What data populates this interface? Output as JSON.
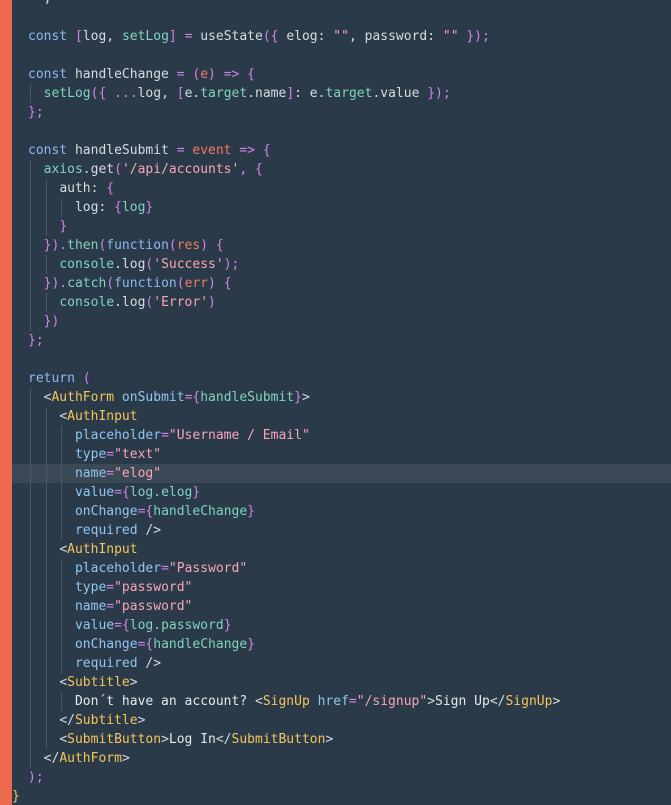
{
  "editor": {
    "colors": {
      "background": "#2b3a48",
      "gutter_accent": "#ee6a4f",
      "current_line": "#3b4956"
    },
    "current_line_index": 25,
    "lines": [
      {
        "indent": 0,
        "tokens": [
          {
            "t": "plain",
            "v": "  ,"
          }
        ]
      },
      {
        "indent": 0,
        "tokens": [
          {
            "t": "plain",
            "v": ""
          }
        ]
      },
      {
        "indent": 0,
        "tokens": [
          {
            "t": "keyword",
            "v": "const "
          },
          {
            "t": "punct",
            "v": "["
          },
          {
            "t": "plain",
            "v": "log, "
          },
          {
            "t": "variable",
            "v": "setLog"
          },
          {
            "t": "punct",
            "v": "] "
          },
          {
            "t": "operator",
            "v": "="
          },
          {
            "t": "plain",
            "v": " useState"
          },
          {
            "t": "punct",
            "v": "({ "
          },
          {
            "t": "plain",
            "v": "elog: "
          },
          {
            "t": "string",
            "v": "\"\""
          },
          {
            "t": "plain",
            "v": ", password: "
          },
          {
            "t": "string",
            "v": "\"\""
          },
          {
            "t": "punct",
            "v": " });"
          }
        ]
      },
      {
        "indent": 0,
        "tokens": [
          {
            "t": "plain",
            "v": ""
          }
        ]
      },
      {
        "indent": 0,
        "tokens": [
          {
            "t": "keyword",
            "v": "const "
          },
          {
            "t": "plain",
            "v": "handleChange "
          },
          {
            "t": "operator",
            "v": "="
          },
          {
            "t": "punct",
            "v": " ("
          },
          {
            "t": "param",
            "v": "e"
          },
          {
            "t": "punct",
            "v": ") "
          },
          {
            "t": "operator",
            "v": "=>"
          },
          {
            "t": "punct",
            "v": " {"
          }
        ]
      },
      {
        "indent": 1,
        "tokens": [
          {
            "t": "variable",
            "v": "setLog"
          },
          {
            "t": "punct",
            "v": "({ "
          },
          {
            "t": "operator",
            "v": "..."
          },
          {
            "t": "plain",
            "v": "log, "
          },
          {
            "t": "punct",
            "v": "["
          },
          {
            "t": "plain",
            "v": "e."
          },
          {
            "t": "variable",
            "v": "target"
          },
          {
            "t": "plain",
            "v": ".name"
          },
          {
            "t": "punct",
            "v": "]"
          },
          {
            "t": "plain",
            "v": ": e."
          },
          {
            "t": "variable",
            "v": "target"
          },
          {
            "t": "plain",
            "v": ".value "
          },
          {
            "t": "punct",
            "v": "});"
          }
        ]
      },
      {
        "indent": 0,
        "tokens": [
          {
            "t": "punct",
            "v": "};"
          }
        ]
      },
      {
        "indent": 0,
        "tokens": [
          {
            "t": "plain",
            "v": ""
          }
        ]
      },
      {
        "indent": 0,
        "tokens": [
          {
            "t": "keyword",
            "v": "const "
          },
          {
            "t": "plain",
            "v": "handleSubmit "
          },
          {
            "t": "operator",
            "v": "="
          },
          {
            "t": "param",
            "v": " event "
          },
          {
            "t": "operator",
            "v": "=>"
          },
          {
            "t": "punct",
            "v": " {"
          }
        ]
      },
      {
        "indent": 1,
        "tokens": [
          {
            "t": "variable",
            "v": "axios"
          },
          {
            "t": "plain",
            "v": ".get"
          },
          {
            "t": "punct",
            "v": "("
          },
          {
            "t": "string",
            "v": "'/api/accounts'"
          },
          {
            "t": "punct",
            "v": ", {"
          }
        ]
      },
      {
        "indent": 2,
        "tokens": [
          {
            "t": "plain",
            "v": "auth: "
          },
          {
            "t": "punct",
            "v": "{"
          }
        ]
      },
      {
        "indent": 3,
        "tokens": [
          {
            "t": "plain",
            "v": "log: "
          },
          {
            "t": "punct",
            "v": "{"
          },
          {
            "t": "variable",
            "v": "log"
          },
          {
            "t": "punct",
            "v": "}"
          }
        ]
      },
      {
        "indent": 2,
        "tokens": [
          {
            "t": "punct",
            "v": "}"
          }
        ]
      },
      {
        "indent": 1,
        "tokens": [
          {
            "t": "punct",
            "v": "})."
          },
          {
            "t": "variable",
            "v": "then"
          },
          {
            "t": "punct",
            "v": "("
          },
          {
            "t": "keyword",
            "v": "function"
          },
          {
            "t": "punct",
            "v": "("
          },
          {
            "t": "param",
            "v": "res"
          },
          {
            "t": "punct",
            "v": ") {"
          }
        ]
      },
      {
        "indent": 2,
        "tokens": [
          {
            "t": "variable",
            "v": "console"
          },
          {
            "t": "plain",
            "v": ".log"
          },
          {
            "t": "punct",
            "v": "("
          },
          {
            "t": "string",
            "v": "'Success'"
          },
          {
            "t": "punct",
            "v": ");"
          }
        ]
      },
      {
        "indent": 1,
        "tokens": [
          {
            "t": "punct",
            "v": "})."
          },
          {
            "t": "variable",
            "v": "catch"
          },
          {
            "t": "punct",
            "v": "("
          },
          {
            "t": "keyword",
            "v": "function"
          },
          {
            "t": "punct",
            "v": "("
          },
          {
            "t": "param",
            "v": "err"
          },
          {
            "t": "punct",
            "v": ") {"
          }
        ]
      },
      {
        "indent": 2,
        "tokens": [
          {
            "t": "variable",
            "v": "console"
          },
          {
            "t": "plain",
            "v": ".log"
          },
          {
            "t": "punct",
            "v": "("
          },
          {
            "t": "string",
            "v": "'Error'"
          },
          {
            "t": "punct",
            "v": ")"
          }
        ]
      },
      {
        "indent": 1,
        "tokens": [
          {
            "t": "punct",
            "v": "})"
          }
        ]
      },
      {
        "indent": 0,
        "tokens": [
          {
            "t": "punct",
            "v": "};"
          }
        ]
      },
      {
        "indent": 0,
        "tokens": [
          {
            "t": "plain",
            "v": ""
          }
        ]
      },
      {
        "indent": 0,
        "tokens": [
          {
            "t": "keyword",
            "v": "return"
          },
          {
            "t": "punct",
            "v": " ("
          }
        ]
      },
      {
        "indent": 1,
        "tokens": [
          {
            "t": "plain",
            "v": "<"
          },
          {
            "t": "tag",
            "v": "AuthForm"
          },
          {
            "t": "attr",
            "v": " onSubmit"
          },
          {
            "t": "operator",
            "v": "="
          },
          {
            "t": "punct",
            "v": "{"
          },
          {
            "t": "variable",
            "v": "handleSubmit"
          },
          {
            "t": "punct",
            "v": "}"
          },
          {
            "t": "plain",
            "v": ">"
          }
        ]
      },
      {
        "indent": 2,
        "tokens": [
          {
            "t": "plain",
            "v": "<"
          },
          {
            "t": "tag",
            "v": "AuthInput"
          }
        ]
      },
      {
        "indent": 3,
        "tokens": [
          {
            "t": "attr",
            "v": "placeholder"
          },
          {
            "t": "operator",
            "v": "="
          },
          {
            "t": "string",
            "v": "\"Username / Email\""
          }
        ]
      },
      {
        "indent": 3,
        "tokens": [
          {
            "t": "attr",
            "v": "type"
          },
          {
            "t": "operator",
            "v": "="
          },
          {
            "t": "string",
            "v": "\"text\""
          }
        ]
      },
      {
        "indent": 3,
        "tokens": [
          {
            "t": "attr",
            "v": "name"
          },
          {
            "t": "operator",
            "v": "="
          },
          {
            "t": "string",
            "v": "\"elog\""
          }
        ]
      },
      {
        "indent": 3,
        "tokens": [
          {
            "t": "attr",
            "v": "value"
          },
          {
            "t": "operator",
            "v": "="
          },
          {
            "t": "punct",
            "v": "{"
          },
          {
            "t": "variable",
            "v": "log.elog"
          },
          {
            "t": "punct",
            "v": "}"
          }
        ]
      },
      {
        "indent": 3,
        "tokens": [
          {
            "t": "attr",
            "v": "onChange"
          },
          {
            "t": "operator",
            "v": "="
          },
          {
            "t": "punct",
            "v": "{"
          },
          {
            "t": "variable",
            "v": "handleChange"
          },
          {
            "t": "punct",
            "v": "}"
          }
        ]
      },
      {
        "indent": 3,
        "tokens": [
          {
            "t": "attr",
            "v": "required"
          },
          {
            "t": "plain",
            "v": " />"
          }
        ]
      },
      {
        "indent": 2,
        "tokens": [
          {
            "t": "plain",
            "v": "<"
          },
          {
            "t": "tag",
            "v": "AuthInput"
          }
        ]
      },
      {
        "indent": 3,
        "tokens": [
          {
            "t": "attr",
            "v": "placeholder"
          },
          {
            "t": "operator",
            "v": "="
          },
          {
            "t": "string",
            "v": "\"Password\""
          }
        ]
      },
      {
        "indent": 3,
        "tokens": [
          {
            "t": "attr",
            "v": "type"
          },
          {
            "t": "operator",
            "v": "="
          },
          {
            "t": "string",
            "v": "\"password\""
          }
        ]
      },
      {
        "indent": 3,
        "tokens": [
          {
            "t": "attr",
            "v": "name"
          },
          {
            "t": "operator",
            "v": "="
          },
          {
            "t": "string",
            "v": "\"password\""
          }
        ]
      },
      {
        "indent": 3,
        "tokens": [
          {
            "t": "attr",
            "v": "value"
          },
          {
            "t": "operator",
            "v": "="
          },
          {
            "t": "punct",
            "v": "{"
          },
          {
            "t": "variable",
            "v": "log.password"
          },
          {
            "t": "punct",
            "v": "}"
          }
        ]
      },
      {
        "indent": 3,
        "tokens": [
          {
            "t": "attr",
            "v": "onChange"
          },
          {
            "t": "operator",
            "v": "="
          },
          {
            "t": "punct",
            "v": "{"
          },
          {
            "t": "variable",
            "v": "handleChange"
          },
          {
            "t": "punct",
            "v": "}"
          }
        ]
      },
      {
        "indent": 3,
        "tokens": [
          {
            "t": "attr",
            "v": "required"
          },
          {
            "t": "plain",
            "v": " />"
          }
        ]
      },
      {
        "indent": 2,
        "tokens": [
          {
            "t": "plain",
            "v": "<"
          },
          {
            "t": "tag",
            "v": "Subtitle"
          },
          {
            "t": "plain",
            "v": ">"
          }
        ]
      },
      {
        "indent": 3,
        "tokens": [
          {
            "t": "text",
            "v": "Don´t have an account? "
          },
          {
            "t": "plain",
            "v": "<"
          },
          {
            "t": "tag",
            "v": "SignUp"
          },
          {
            "t": "attr",
            "v": " href"
          },
          {
            "t": "operator",
            "v": "="
          },
          {
            "t": "string",
            "v": "\"/signup\""
          },
          {
            "t": "plain",
            "v": ">"
          },
          {
            "t": "text",
            "v": "Sign Up"
          },
          {
            "t": "plain",
            "v": "</"
          },
          {
            "t": "tag",
            "v": "SignUp"
          },
          {
            "t": "plain",
            "v": ">"
          }
        ]
      },
      {
        "indent": 2,
        "tokens": [
          {
            "t": "plain",
            "v": "</"
          },
          {
            "t": "tag",
            "v": "Subtitle"
          },
          {
            "t": "plain",
            "v": ">"
          }
        ]
      },
      {
        "indent": 2,
        "tokens": [
          {
            "t": "plain",
            "v": "<"
          },
          {
            "t": "tag",
            "v": "SubmitButton"
          },
          {
            "t": "plain",
            "v": ">"
          },
          {
            "t": "text",
            "v": "Log In"
          },
          {
            "t": "plain",
            "v": "</"
          },
          {
            "t": "tag",
            "v": "SubmitButton"
          },
          {
            "t": "plain",
            "v": ">"
          }
        ]
      },
      {
        "indent": 1,
        "tokens": [
          {
            "t": "plain",
            "v": "</"
          },
          {
            "t": "tag",
            "v": "AuthForm"
          },
          {
            "t": "plain",
            "v": ">"
          }
        ]
      },
      {
        "indent": 0,
        "tokens": [
          {
            "t": "punct",
            "v": ");"
          }
        ]
      },
      {
        "indent": -1,
        "tokens": [
          {
            "t": "tag",
            "v": "}"
          }
        ]
      }
    ]
  }
}
